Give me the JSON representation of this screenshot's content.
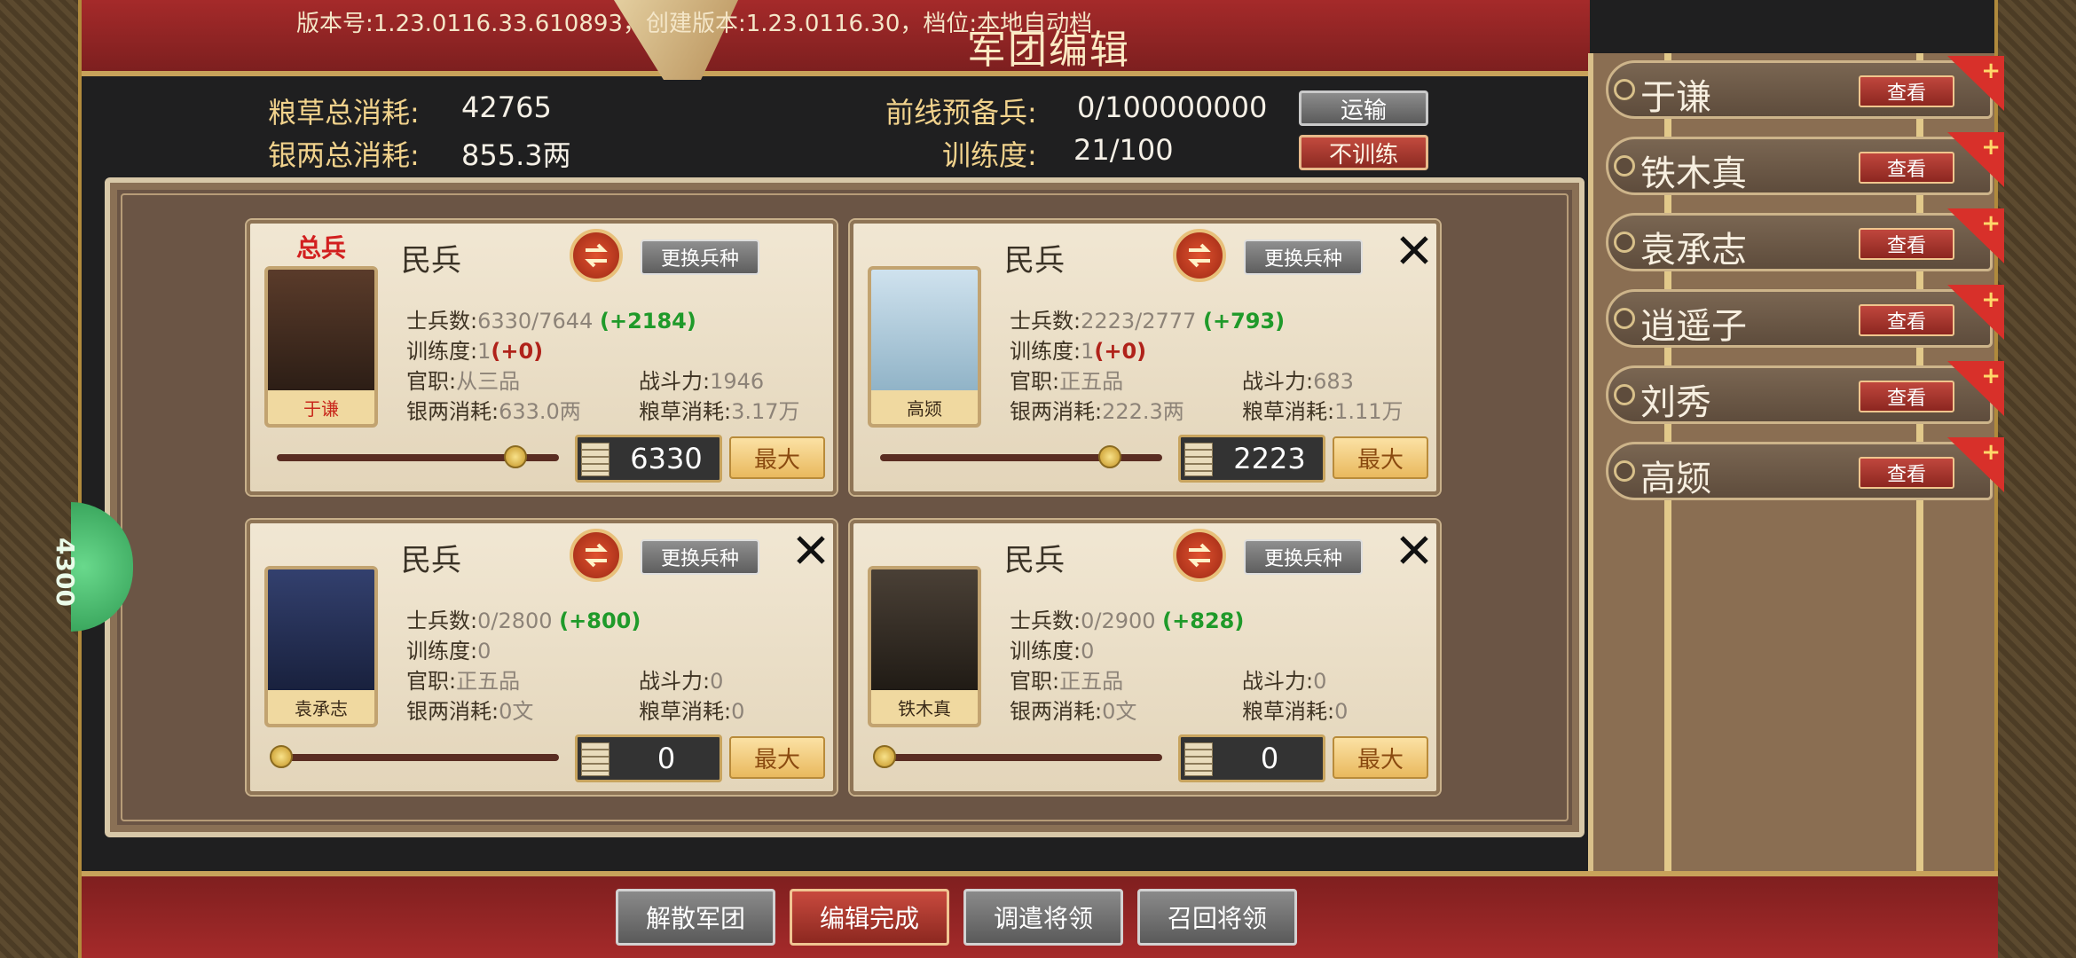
{
  "header": {
    "version_text": "版本号:1.23.0116.33.610893，创建版本:1.23.0116.30，档位:本地自动档",
    "title": "军团编辑"
  },
  "stats": {
    "grain_label": "粮草总消耗:",
    "grain_value": "42765",
    "silver_label": "银两总消耗:",
    "silver_value": "855.3两",
    "reserve_label": "前线预备兵:",
    "reserve_value": "0/100000000",
    "transport_button": "运输",
    "training_label": "训练度:",
    "training_value": "21/100",
    "no_training_button": "不训练"
  },
  "side_badge": "4300",
  "cards": [
    {
      "commander_tag": "总兵",
      "general": "于谦",
      "unit_type": "民兵",
      "change_button": "更换兵种",
      "soldiers_label": "士兵数:",
      "soldiers_value": "6330/7644",
      "soldiers_bonus": "(+2184)",
      "training_label": "训练度:",
      "training_value": "1",
      "training_bonus": "(+0)",
      "rank_label": "官职:",
      "rank_value": "从三品",
      "power_label": "战斗力:",
      "power_value": "1946",
      "silver_label": "银两消耗:",
      "silver_value": "633.0两",
      "grain_label": "粮草消耗:",
      "grain_value": "3.17万",
      "quantity": "6330",
      "slider_fraction": 0.83,
      "max_button": "最大",
      "closable": false
    },
    {
      "commander_tag": "",
      "general": "高颎",
      "unit_type": "民兵",
      "change_button": "更换兵种",
      "soldiers_label": "士兵数:",
      "soldiers_value": "2223/2777",
      "soldiers_bonus": "(+793)",
      "training_label": "训练度:",
      "training_value": "1",
      "training_bonus": "(+0)",
      "rank_label": "官职:",
      "rank_value": "正五品",
      "power_label": "战斗力:",
      "power_value": "683",
      "silver_label": "银两消耗:",
      "silver_value": "222.3两",
      "grain_label": "粮草消耗:",
      "grain_value": "1.11万",
      "quantity": "2223",
      "slider_fraction": 0.8,
      "max_button": "最大",
      "closable": true
    },
    {
      "commander_tag": "",
      "general": "袁承志",
      "unit_type": "民兵",
      "change_button": "更换兵种",
      "soldiers_label": "士兵数:",
      "soldiers_value": "0/2800",
      "soldiers_bonus": "(+800)",
      "training_label": "训练度:",
      "training_value": "0",
      "training_bonus": "",
      "rank_label": "官职:",
      "rank_value": "正五品",
      "power_label": "战斗力:",
      "power_value": "0",
      "silver_label": "银两消耗:",
      "silver_value": "0文",
      "grain_label": "粮草消耗:",
      "grain_value": "0",
      "quantity": "0",
      "slider_fraction": 0,
      "max_button": "最大",
      "closable": true
    },
    {
      "commander_tag": "",
      "general": "铁木真",
      "unit_type": "民兵",
      "change_button": "更换兵种",
      "soldiers_label": "士兵数:",
      "soldiers_value": "0/2900",
      "soldiers_bonus": "(+828)",
      "training_label": "训练度:",
      "training_value": "0",
      "training_bonus": "",
      "rank_label": "官职:",
      "rank_value": "正五品",
      "power_label": "战斗力:",
      "power_value": "0",
      "silver_label": "银两消耗:",
      "silver_value": "0文",
      "grain_label": "粮草消耗:",
      "grain_value": "0",
      "quantity": "0",
      "slider_fraction": 0,
      "max_button": "最大",
      "closable": true
    }
  ],
  "generals": [
    {
      "name": "于谦",
      "view": "查看"
    },
    {
      "name": "铁木真",
      "view": "查看"
    },
    {
      "name": "袁承志",
      "view": "查看"
    },
    {
      "name": "逍遥子",
      "view": "查看"
    },
    {
      "name": "刘秀",
      "view": "查看"
    },
    {
      "name": "高颎",
      "view": "查看"
    }
  ],
  "bottom_buttons": {
    "disband": "解散军团",
    "done": "编辑完成",
    "dispatch": "调遣将领",
    "recall": "召回将领"
  },
  "colors": {
    "banner_red": "#a52a2a",
    "gold_text": "#f1d28c",
    "bonus_green": "#1f9a2a",
    "bonus_red": "#b0221a",
    "commander_red": "#d21f1f"
  }
}
